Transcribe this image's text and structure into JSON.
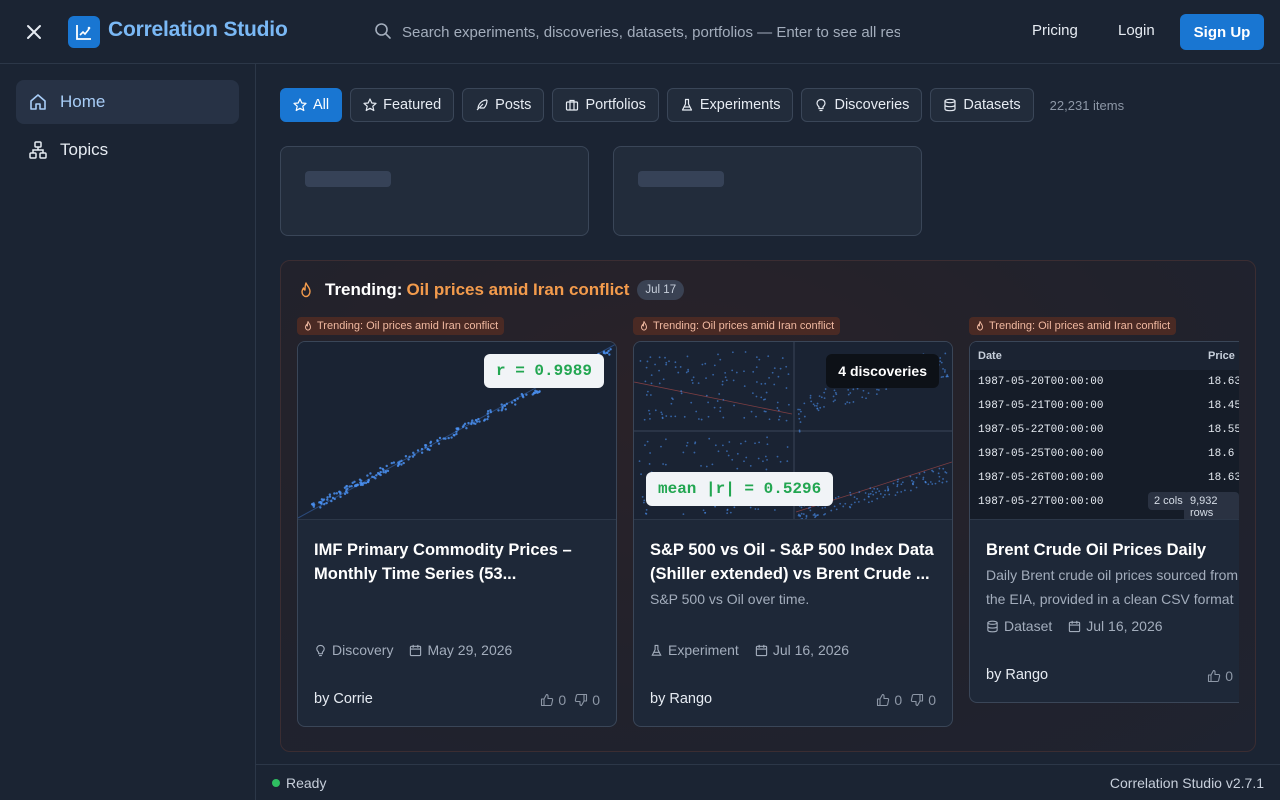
{
  "header": {
    "brand": "Correlation Studio",
    "search_placeholder": "Search experiments, discoveries, datasets, portfolios — Enter to see all results",
    "pricing": "Pricing",
    "login": "Login",
    "signup": "Sign Up"
  },
  "sidebar": {
    "items": [
      {
        "label": "Home",
        "icon": "home-icon",
        "active": true
      },
      {
        "label": "Topics",
        "icon": "topics-icon",
        "active": false
      }
    ]
  },
  "filters": {
    "chips": [
      {
        "label": "All",
        "icon": "star-icon",
        "active": true
      },
      {
        "label": "Featured",
        "icon": "star-icon"
      },
      {
        "label": "Posts",
        "icon": "feather-icon"
      },
      {
        "label": "Portfolios",
        "icon": "briefcase-icon"
      },
      {
        "label": "Experiments",
        "icon": "flask-icon"
      },
      {
        "label": "Discoveries",
        "icon": "lightbulb-icon"
      },
      {
        "label": "Datasets",
        "icon": "database-icon"
      }
    ],
    "count": "22,231 items"
  },
  "trending": {
    "label": "Trending:",
    "topic": "Oil prices amid Iran conflict",
    "date": "Jul 17",
    "badge": "Trending: Oil prices amid Iran conflict",
    "cards": [
      {
        "stat": "r = 0.9989",
        "title": "IMF Primary Commodity Prices – Monthly Time Series (53...",
        "type": "Discovery",
        "date": "May 29, 2026",
        "author": "by Corrie",
        "likes": "0",
        "dislikes": "0"
      },
      {
        "stat": "mean |r| = 0.5296",
        "discoveries": "4 discoveries",
        "title": "S&P 500 vs Oil - S&P 500 Index Data (Shiller extended) vs Brent Crude ...",
        "desc": "S&P 500 vs Oil over time.",
        "type": "Experiment",
        "date": "Jul 16, 2026",
        "author": "by Rango",
        "likes": "0",
        "dislikes": "0"
      },
      {
        "title": "Brent Crude Oil Prices Daily",
        "desc1": "Daily Brent crude oil prices sourced from",
        "desc2": "the EIA, provided in a clean CSV format",
        "type": "Dataset",
        "date": "Jul 16, 2026",
        "author": "by Rango",
        "likes": "0",
        "table": {
          "col_date": "Date",
          "col_price": "Price",
          "rows": [
            {
              "d": "1987-05-20T00:00:00",
              "p": "18.63"
            },
            {
              "d": "1987-05-21T00:00:00",
              "p": "18.45"
            },
            {
              "d": "1987-05-22T00:00:00",
              "p": "18.55"
            },
            {
              "d": "1987-05-25T00:00:00",
              "p": "18.6"
            },
            {
              "d": "1987-05-26T00:00:00",
              "p": "18.63"
            },
            {
              "d": "1987-05-27T00:00:00",
              "p": ""
            }
          ],
          "cols": "2 cols",
          "rows_count": "9,932 rows"
        }
      }
    ]
  },
  "status": {
    "text": "Ready",
    "version": "Correlation Studio v2.7.1"
  },
  "colors": {
    "accent": "#1976d2",
    "brand_text": "#7ab8f5",
    "trending_topic": "#f39b4c",
    "ready_dot": "#2fbf61",
    "stat_green": "#22a651"
  }
}
